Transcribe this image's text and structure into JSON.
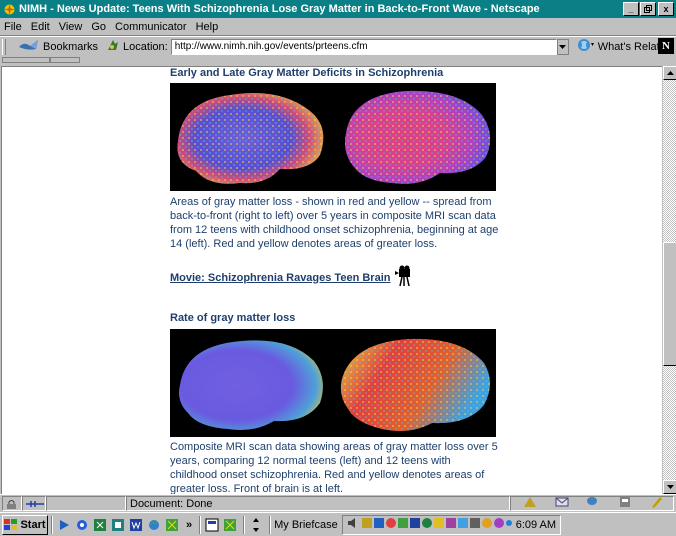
{
  "window": {
    "title": "NIMH - News Update: Teens With Schizophrenia Lose Gray Matter in Back-to-Front Wave - Netscape",
    "minimize": "_",
    "maximize": " ",
    "close": "x"
  },
  "menu": {
    "file": "File",
    "edit": "Edit",
    "view": "View",
    "go": "Go",
    "communicator": "Communicator",
    "help": "Help"
  },
  "toolbar": {
    "bookmarks": "Bookmarks",
    "location_label": "Location:",
    "url": "http://www.nimh.nih.gov/events/prteens.cfm",
    "whats_related": "What's Related",
    "logo": "N"
  },
  "content": {
    "heading1": "Early and Late Gray Matter Deficits in Schizophrenia",
    "paragraph1": "Areas of gray matter loss - shown in red and yellow -- spread from back-to-front (right to left) over 5 years in composite MRI scan data from 12 teens with childhood onset schizophrenia, beginning at age 14 (left). Red and yellow denotes areas of greater loss.",
    "movie_link": "Movie: Schizophrenia Ravages Teen Brain",
    "heading2": "Rate of gray matter loss",
    "paragraph2": "Composite MRI scan data showing areas of gray matter loss over 5 years, comparing 12 normal teens (left) and 12 teens with childhood onset schizophrenia. Red and yellow denotes areas of greater loss. Front of brain is at left."
  },
  "status": {
    "text": "Document: Done"
  },
  "taskbar": {
    "start": "Start",
    "chevron": "»",
    "briefcase": "My Briefcase",
    "clock": "6:09 AM"
  },
  "colors": {
    "title_bar": "#0b7f86",
    "chrome": "#c0c0c0",
    "text_blue": "#1e3f6e"
  }
}
